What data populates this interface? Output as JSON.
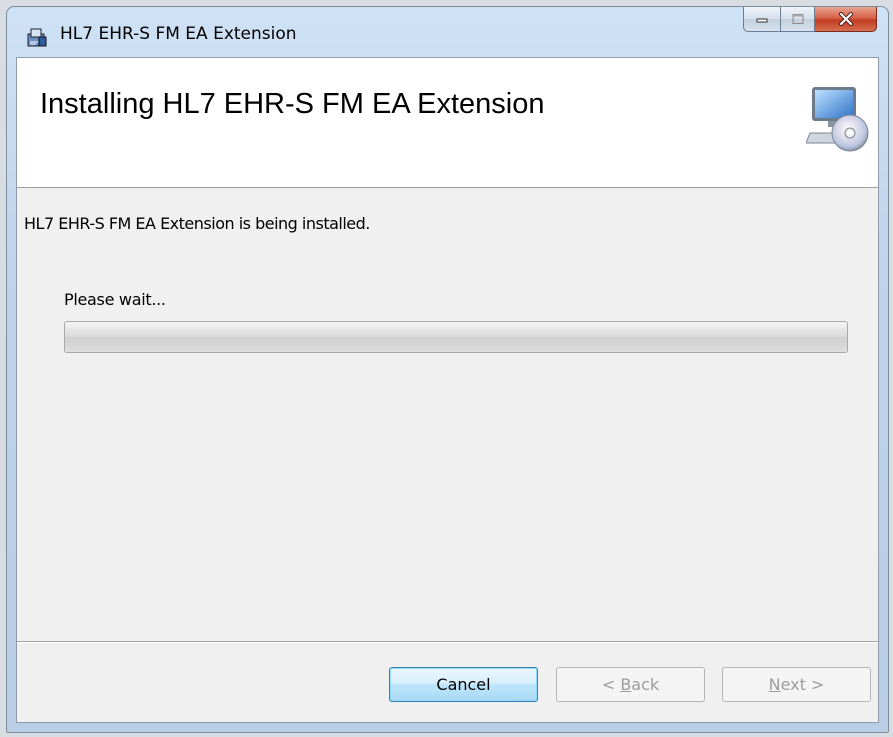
{
  "window": {
    "title": "HL7 EHR-S FM EA Extension",
    "icons": {
      "app": "installer-icon",
      "minimize": "minimize-icon",
      "maximize": "maximize-icon",
      "close": "close-icon"
    }
  },
  "header": {
    "title": "Installing HL7 EHR-S FM EA Extension",
    "icon": "computer-cd-icon"
  },
  "body": {
    "status": "HL7 EHR-S FM EA Extension is being installed.",
    "progress_label": "Please wait...",
    "progress_value": 0
  },
  "buttons": {
    "cancel": "Cancel",
    "back_prefix": "< ",
    "back_accel": "B",
    "back_rest": "ack",
    "next_accel": "N",
    "next_rest": "ext >"
  },
  "colors": {
    "accent": "#3c7fb1",
    "close_button": "#c23c21"
  }
}
